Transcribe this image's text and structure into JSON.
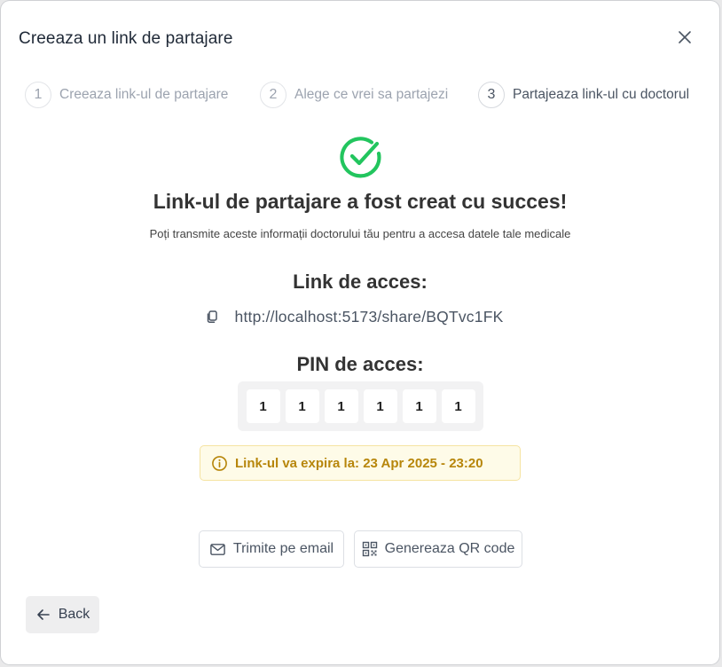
{
  "dialog": {
    "title": "Creeaza un link de partajare",
    "close_icon": "close-icon"
  },
  "steps": [
    {
      "number": "1",
      "label": "Creeaza link-ul de partajare",
      "active": false
    },
    {
      "number": "2",
      "label": "Alege ce vrei sa partajezi",
      "active": false
    },
    {
      "number": "3",
      "label": "Partajeaza link-ul cu doctorul",
      "active": true
    }
  ],
  "success": {
    "icon": "check-circle-icon",
    "title": "Link-ul de partajare a fost creat cu succes!",
    "subtitle": "Poți transmite aceste informații doctorului tău pentru a accesa datele tale medicale"
  },
  "access_link": {
    "heading": "Link de acces:",
    "icon": "copy-icon",
    "url": "http://localhost:5173/share/BQTvc1FK"
  },
  "access_pin": {
    "heading": "PIN de acces:",
    "digits": [
      "1",
      "1",
      "1",
      "1",
      "1",
      "1"
    ]
  },
  "expiry": {
    "icon": "info-icon",
    "text": "Link-ul va expira la: 23 Apr 2025 - 23:20"
  },
  "actions": {
    "email_icon": "mail-icon",
    "email_label": "Trimite pe email",
    "qr_icon": "qr-code-icon",
    "qr_label": "Genereaza QR code"
  },
  "footer": {
    "back_icon": "arrow-left-icon",
    "back_label": "Back"
  },
  "colors": {
    "success": "#22c55e",
    "warning_text": "#b7860b",
    "warning_bg": "#fefbe8",
    "warning_border": "#f5e3a1"
  }
}
